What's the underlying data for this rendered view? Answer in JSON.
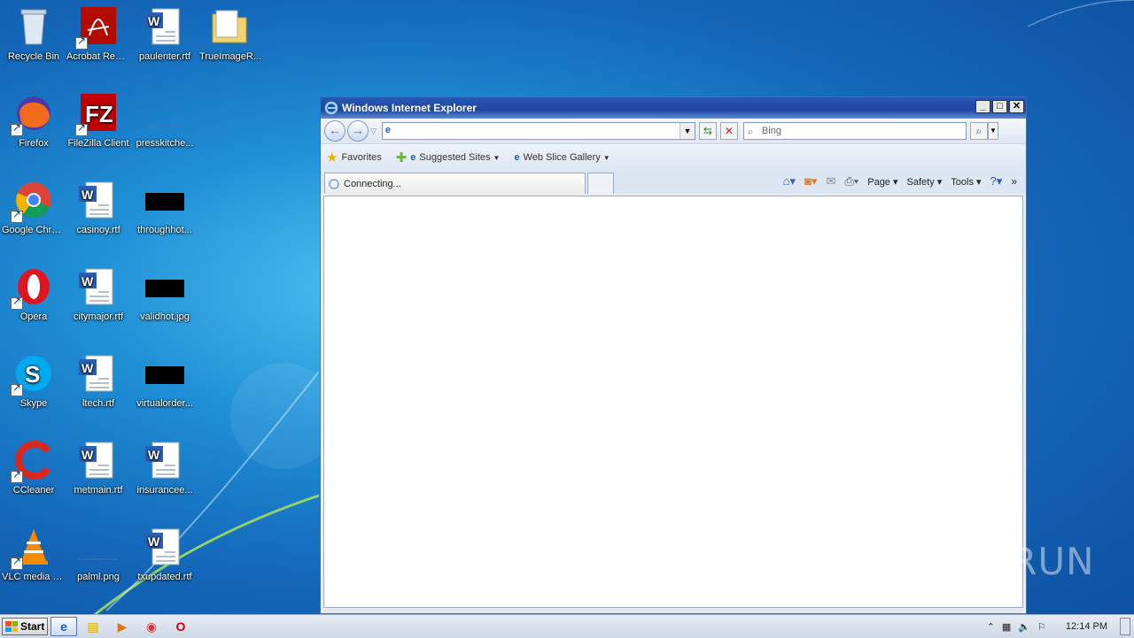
{
  "desktop": {
    "icons": [
      {
        "label": "Recycle Bin",
        "icon": "recycle-bin-icon"
      },
      {
        "label": "Acrobat Reader DC",
        "icon": "acrobat-icon"
      },
      {
        "label": "paulenter.rtf",
        "icon": "word-doc-icon"
      },
      {
        "label": "TrueImageR...",
        "icon": "folder-icon"
      },
      {
        "label": "Firefox",
        "icon": "firefox-icon"
      },
      {
        "label": "FileZilla Client",
        "icon": "filezilla-icon"
      },
      {
        "label": "presskitche...",
        "icon": "blank-file-icon"
      },
      {
        "label": "Google Chrome",
        "icon": "chrome-icon"
      },
      {
        "label": "casinoy.rtf",
        "icon": "word-doc-icon"
      },
      {
        "label": "throughhot...",
        "icon": "image-thumb-icon"
      },
      {
        "label": "Opera",
        "icon": "opera-icon"
      },
      {
        "label": "citymajor.rtf",
        "icon": "word-doc-icon"
      },
      {
        "label": "validhot.jpg",
        "icon": "image-thumb-icon"
      },
      {
        "label": "Skype",
        "icon": "skype-icon"
      },
      {
        "label": "ltech.rtf",
        "icon": "word-doc-icon"
      },
      {
        "label": "virtualorder...",
        "icon": "image-thumb-icon"
      },
      {
        "label": "CCleaner",
        "icon": "ccleaner-icon"
      },
      {
        "label": "metmain.rtf",
        "icon": "word-doc-icon"
      },
      {
        "label": "insurancee...",
        "icon": "word-doc-icon"
      },
      {
        "label": "VLC media player",
        "icon": "vlc-icon"
      },
      {
        "label": "palml.png",
        "icon": "blank-file-icon"
      },
      {
        "label": "txupdated.rtf",
        "icon": "word-doc-icon"
      }
    ]
  },
  "ie": {
    "title": "Windows Internet Explorer",
    "address_value": "",
    "search_placeholder": "Bing",
    "favorites_label": "Favorites",
    "suggested_sites": "Suggested Sites",
    "web_slice_gallery": "Web Slice Gallery",
    "tab_label": "Connecting...",
    "cmd": {
      "page": "Page",
      "safety": "Safety",
      "tools": "Tools"
    }
  },
  "taskbar": {
    "start_label": "Start",
    "clock": "12:14 PM"
  },
  "watermark": "ANY RUN",
  "colors": {
    "desktop_blue": "#1466b8",
    "title_blue": "#1c46a0"
  }
}
